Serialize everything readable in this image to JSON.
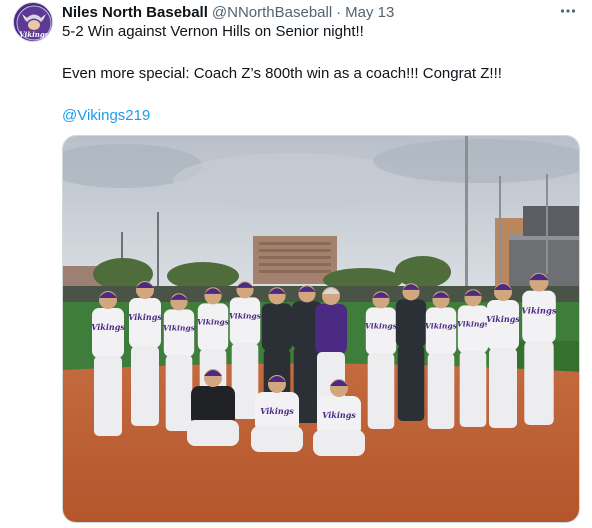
{
  "tweet": {
    "author": {
      "display_name": "Niles North Baseball",
      "handle": "@NNorthBaseball",
      "avatar_text": "Vikings"
    },
    "separator": "·",
    "date": "May 13",
    "text_line_1": "5-2 Win against Vernon Hills on Senior night!!",
    "text_line_2": "Even more special: Coach Z’s 800th win as a coach!!! Congrat Z!!!",
    "mention": "@Vikings219",
    "media": {
      "description_type": "photo",
      "jersey_text": "Vikings",
      "colors": {
        "sky": "#c9cfd6",
        "dirt": "#c0643a",
        "turf": "#3f7d3a",
        "jersey": "#f2f2f4",
        "team_purple": "#4b2a83"
      }
    }
  },
  "icons": {
    "more": "more-horizontal-icon"
  }
}
